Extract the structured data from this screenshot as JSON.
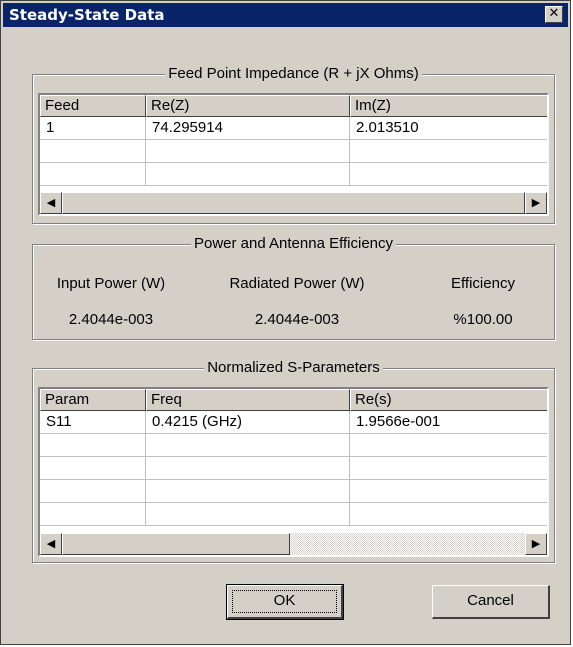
{
  "window": {
    "title": "Steady-State Data",
    "close_glyph": "✕"
  },
  "impedance": {
    "group_label": "Feed Point Impedance (R + jX Ohms)",
    "columns": [
      "Feed",
      "Re(Z)",
      "Im(Z)"
    ],
    "rows": [
      [
        "1",
        "74.295914",
        "2.013510"
      ],
      [
        "",
        "",
        ""
      ],
      [
        "",
        "",
        ""
      ]
    ]
  },
  "power": {
    "group_label": "Power and Antenna Efficiency",
    "input_label": "Input Power (W)",
    "radiated_label": "Radiated Power (W)",
    "efficiency_label": "Efficiency",
    "input_value": "2.4044e-003",
    "radiated_value": "2.4044e-003",
    "efficiency_value": "%100.00"
  },
  "sparams": {
    "group_label": "Normalized S-Parameters",
    "columns": [
      "Param",
      "Freq",
      "Re(s)"
    ],
    "rows": [
      [
        "S11",
        "0.4215 (GHz)",
        "1.9566e-001"
      ],
      [
        "",
        "",
        ""
      ],
      [
        "",
        "",
        ""
      ],
      [
        "",
        "",
        ""
      ],
      [
        "",
        "",
        ""
      ]
    ]
  },
  "buttons": {
    "ok": "OK",
    "cancel": "Cancel"
  },
  "icons": {
    "scroll_left": "triangle-left-icon",
    "scroll_right": "triangle-right-icon"
  }
}
